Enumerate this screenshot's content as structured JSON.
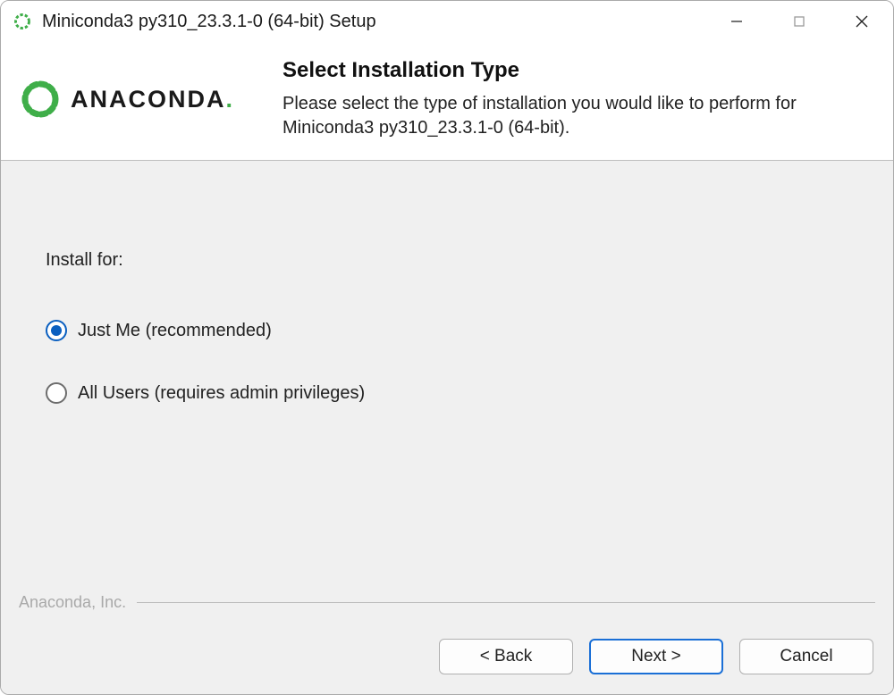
{
  "titlebar": {
    "title": "Miniconda3 py310_23.3.1-0 (64-bit) Setup"
  },
  "header": {
    "logo_text": "ANACONDA",
    "logo_suffix": ".",
    "heading": "Select Installation Type",
    "description": "Please select the type of installation you would like to perform for Miniconda3 py310_23.3.1-0 (64-bit)."
  },
  "body": {
    "install_for_label": "Install for:",
    "options": [
      {
        "label": "Just Me (recommended)",
        "selected": true
      },
      {
        "label": "All Users (requires admin privileges)",
        "selected": false
      }
    ]
  },
  "footer": {
    "company": "Anaconda, Inc.",
    "back_label": "< Back",
    "next_label": "Next >",
    "cancel_label": "Cancel"
  }
}
